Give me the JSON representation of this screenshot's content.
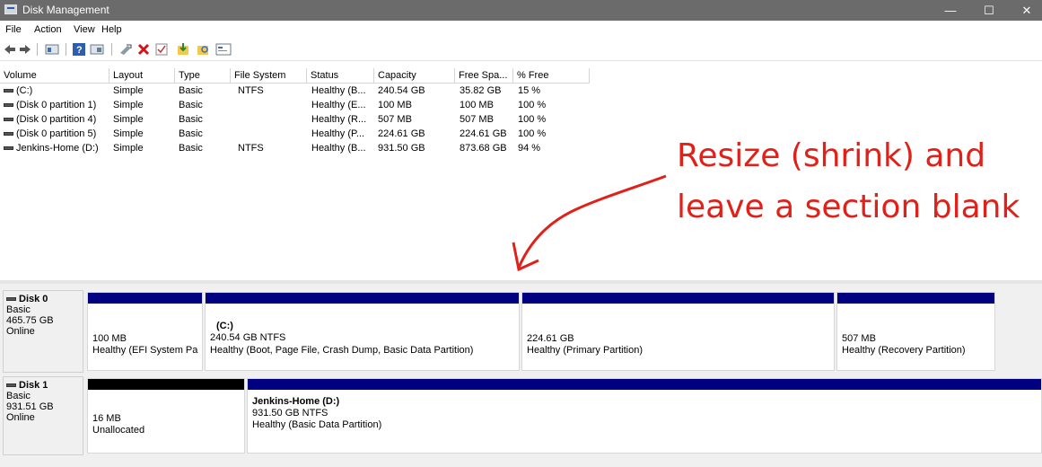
{
  "window": {
    "title": "Disk Management",
    "minimize": "—",
    "maximize": "☐",
    "close": "✕"
  },
  "menu": [
    "File",
    "Action",
    "View",
    "Help"
  ],
  "toolbar_icons": [
    "back-icon",
    "forward-icon",
    "show-disk-icon",
    "help-icon",
    "console-icon",
    "connect-icon",
    "delete-icon",
    "check-icon",
    "import-icon",
    "rescan-icon",
    "properties-icon"
  ],
  "volumes": {
    "headers": [
      "Volume",
      "Layout",
      "Type",
      "File System",
      "Status",
      "Capacity",
      "Free Spa...",
      "% Free"
    ],
    "rows": [
      [
        "(C:)",
        "Simple",
        "Basic",
        "NTFS",
        "Healthy (B...",
        "240.54 GB",
        "35.82 GB",
        "15 %"
      ],
      [
        "(Disk 0 partition 1)",
        "Simple",
        "Basic",
        "",
        "Healthy (E...",
        "100 MB",
        "100 MB",
        "100 %"
      ],
      [
        "(Disk 0 partition 4)",
        "Simple",
        "Basic",
        "",
        "Healthy (R...",
        "507 MB",
        "507 MB",
        "100 %"
      ],
      [
        "(Disk 0 partition 5)",
        "Simple",
        "Basic",
        "",
        "Healthy (P...",
        "224.61 GB",
        "224.61 GB",
        "100 %"
      ],
      [
        "Jenkins-Home (D:)",
        "Simple",
        "Basic",
        "NTFS",
        "Healthy (B...",
        "931.50 GB",
        "873.68 GB",
        "94 %"
      ]
    ]
  },
  "annotation": {
    "line1": "Resize (shrink) and",
    "line2": "leave a section blank",
    "color": "#e0211a"
  },
  "disks": [
    {
      "name": "Disk 0",
      "type": "Basic",
      "size": "465.75 GB",
      "status": "Online",
      "partitions": [
        {
          "label": "",
          "l1": "100 MB",
          "l2": "Healthy (EFI System Pa",
          "bar": "#000080"
        },
        {
          "label": "(C:)",
          "l1": "240.54 GB NTFS",
          "l2": "Healthy (Boot, Page File, Crash Dump, Basic Data Partition)",
          "bar": "#000080"
        },
        {
          "label": "",
          "l1": "224.61 GB",
          "l2": "Healthy (Primary Partition)",
          "bar": "#000080"
        },
        {
          "label": "",
          "l1": "507 MB",
          "l2": "Healthy (Recovery Partition)",
          "bar": "#000080"
        }
      ]
    },
    {
      "name": "Disk 1",
      "type": "Basic",
      "size": "931.51 GB",
      "status": "Online",
      "partitions": [
        {
          "label": "",
          "l1": "16 MB",
          "l2": "Unallocated",
          "bar": "#000000"
        },
        {
          "label": "Jenkins-Home  (D:)",
          "l1": "931.50 GB NTFS",
          "l2": "Healthy (Basic Data Partition)",
          "bar": "#000080"
        }
      ]
    }
  ]
}
